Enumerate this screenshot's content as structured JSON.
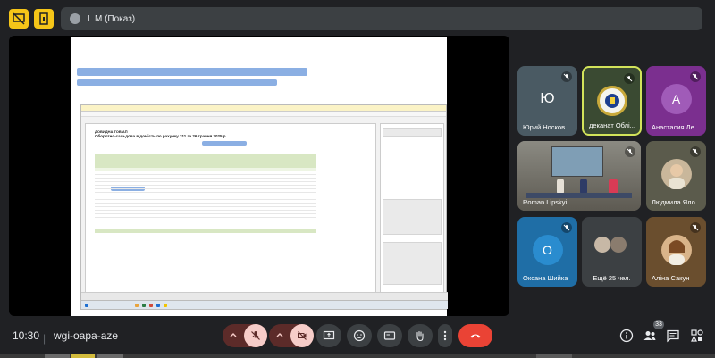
{
  "header": {
    "presenter_label": "L M (Показ)"
  },
  "participants": [
    {
      "id": "p1",
      "name": "Юрий Носков",
      "initial": "Ю",
      "color": "#4a5a63",
      "muted": true
    },
    {
      "id": "p2",
      "name": "деканат Облі...",
      "initial": "",
      "color": "#3a4a32",
      "muted": true,
      "active": true
    },
    {
      "id": "p3",
      "name": "Анастасия Ле...",
      "initial": "А",
      "color": "#7b2f8f",
      "muted": true
    },
    {
      "id": "p4",
      "name": "Roman Lipskyi",
      "initial": "",
      "color": "#6b6a64",
      "muted": true
    },
    {
      "id": "p5",
      "name": "Людмила Яло...",
      "initial": "",
      "color": "#5b5b4c",
      "muted": true
    },
    {
      "id": "p6",
      "name": "Оксана Шийка",
      "initial": "О",
      "color": "#1f6ea6",
      "muted": true
    },
    {
      "id": "p7",
      "name": "Ещё 25 чел.",
      "initial": "",
      "color": "#3c4043",
      "muted": false
    },
    {
      "id": "p8",
      "name": "Аліна Сакун",
      "initial": "",
      "color": "#6a4e2e",
      "muted": true
    }
  ],
  "footer": {
    "time": "10:30",
    "separator": "|",
    "meeting_code": "wgi-oapa-aze",
    "people_count": "33"
  },
  "shared_screen": {
    "doc_title": "ДОВИДНА ТОВ АП",
    "doc_subtitle": "Оборотно-сальдова відомість по рахунку 311 за 26 травня 2025 р."
  },
  "colors": {
    "background": "#202124",
    "accent_yellow": "#f5c518",
    "leave_red": "#ea4335",
    "mute_bg": "#5c2b29",
    "mute_on": "#f6cdc9"
  }
}
